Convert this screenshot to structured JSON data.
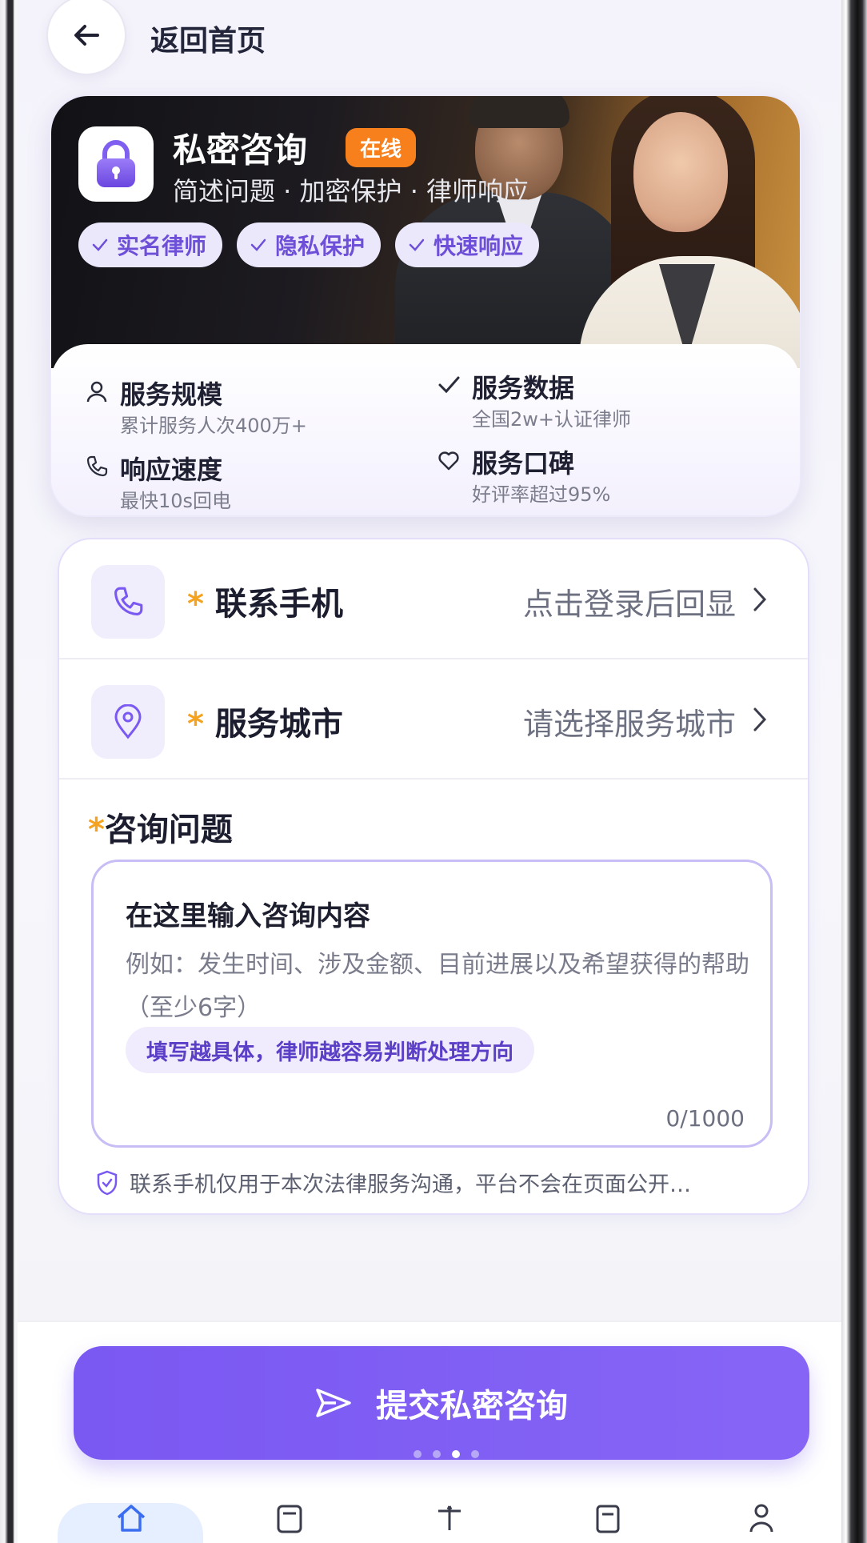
{
  "header": {
    "back_label": "返回首页"
  },
  "hero": {
    "title": "私密咨询",
    "badge": "在线",
    "subtitle": "简述问题 · 加密保护 · 律师响应",
    "chips": [
      "实名律师",
      "隐私保护",
      "快速响应"
    ],
    "stats": [
      {
        "title": "服务规模",
        "desc": "累计服务人次400万+",
        "icon": "user-icon"
      },
      {
        "title": "服务数据",
        "desc": "全国2w+认证律师",
        "icon": "check-icon"
      },
      {
        "title": "响应速度",
        "desc": "最快10s回电",
        "icon": "phone-icon"
      },
      {
        "title": "服务口碑",
        "desc": "好评率超过95%",
        "icon": "heart-icon"
      }
    ]
  },
  "form": {
    "phone": {
      "label": "联系手机",
      "value": "点击登录后回显"
    },
    "city": {
      "label": "服务城市",
      "value": "请选择服务城市"
    },
    "question": {
      "label": "咨询问题",
      "box_title": "在这里输入咨询内容",
      "placeholder": "例如：发生时间、涉及金额、目前进展以及希望获得的帮助（至少6字）",
      "tip": "填写越具体，律师越容易判断处理方向",
      "counter": "0/1000"
    },
    "privacy_note": "联系手机仅用于本次法律服务沟通，平台不会在页面公开…"
  },
  "submit": {
    "label": "提交私密咨询"
  },
  "colors": {
    "accent": "#7a58f2",
    "badge": "#f7801d",
    "required": "#f5a21e"
  }
}
